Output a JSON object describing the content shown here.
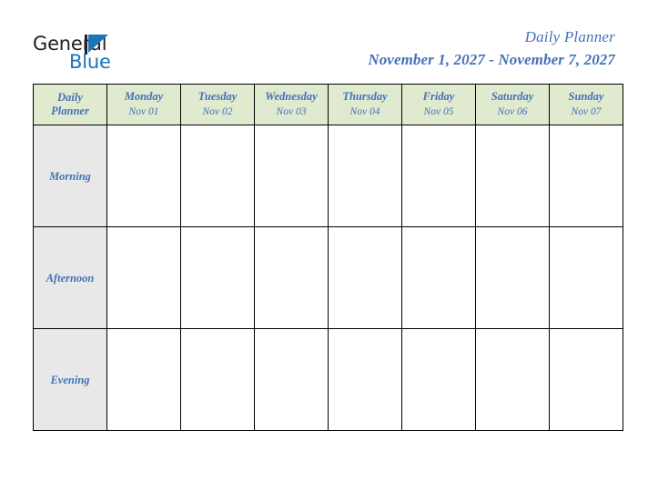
{
  "brand": {
    "name_part1": "General",
    "name_part2": "Blue",
    "logo_icon": "triangle-flag-icon",
    "blue": "#1b75bb",
    "dark": "#231f20"
  },
  "header": {
    "title": "Daily Planner",
    "date_range": "November 1, 2027 - November 7, 2027",
    "accent_color": "#4472b8"
  },
  "table": {
    "corner_label_line1": "Daily",
    "corner_label_line2": "Planner",
    "header_bg": "#dfeacf",
    "period_bg": "#e8e8e8",
    "border_color": "#000000",
    "columns": [
      {
        "day": "Monday",
        "date": "Nov 01"
      },
      {
        "day": "Tuesday",
        "date": "Nov 02"
      },
      {
        "day": "Wednesday",
        "date": "Nov 03"
      },
      {
        "day": "Thursday",
        "date": "Nov 04"
      },
      {
        "day": "Friday",
        "date": "Nov 05"
      },
      {
        "day": "Saturday",
        "date": "Nov 06"
      },
      {
        "day": "Sunday",
        "date": "Nov 07"
      }
    ],
    "rows": [
      {
        "period": "Morning",
        "entries": [
          "",
          "",
          "",
          "",
          "",
          "",
          ""
        ]
      },
      {
        "period": "Afternoon",
        "entries": [
          "",
          "",
          "",
          "",
          "",
          "",
          ""
        ]
      },
      {
        "period": "Evening",
        "entries": [
          "",
          "",
          "",
          "",
          "",
          "",
          ""
        ]
      }
    ]
  }
}
